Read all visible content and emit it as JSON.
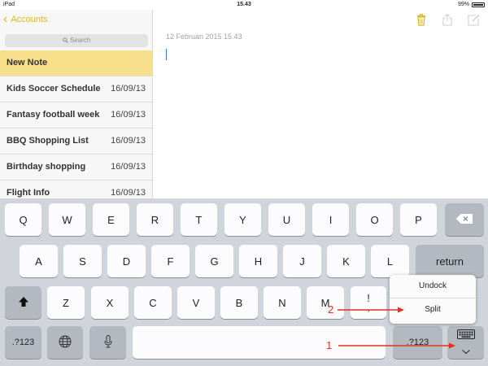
{
  "status_bar": {
    "device": "iPad",
    "time": "15.43",
    "battery": "99%"
  },
  "sidebar": {
    "back_label": "Accounts",
    "search_placeholder": "Search",
    "notes": [
      {
        "title": "New Note",
        "date": ""
      },
      {
        "title": "Kids Soccer Schedule",
        "date": "16/09/13"
      },
      {
        "title": "Fantasy football week",
        "date": "16/09/13"
      },
      {
        "title": "BBQ Shopping List",
        "date": "16/09/13"
      },
      {
        "title": "Birthday shopping",
        "date": "16/09/13"
      },
      {
        "title": "Flight Info",
        "date": "16/09/13"
      }
    ]
  },
  "note": {
    "date": "12 Februari 2015 15.43",
    "accent": "#e2b51a"
  },
  "keyboard": {
    "row1": [
      "Q",
      "W",
      "E",
      "R",
      "T",
      "Y",
      "U",
      "I",
      "O",
      "P"
    ],
    "row2": [
      "A",
      "S",
      "D",
      "F",
      "G",
      "H",
      "J",
      "K",
      "L"
    ],
    "return_label": "return",
    "row3": [
      "Z",
      "X",
      "C",
      "V",
      "B",
      "N",
      "M"
    ],
    "exclaim": "!",
    "comma": ",",
    "numbers_left": ".?123",
    "numbers_right": ".?123"
  },
  "keyboard_menu": {
    "undock": "Undock",
    "split": "Split"
  },
  "annotations": {
    "label_1": "1",
    "label_2": "2",
    "color": "#e0321d"
  }
}
